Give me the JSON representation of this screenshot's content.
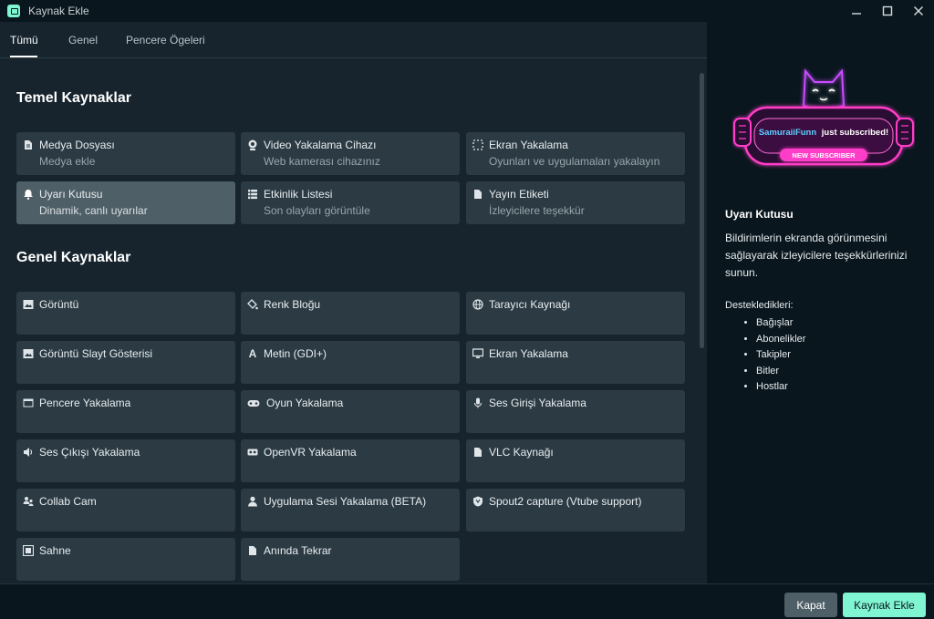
{
  "window": {
    "title": "Kaynak Ekle",
    "minimize_icon": "minimize-icon",
    "maximize_icon": "maximize-icon",
    "close_icon": "close-icon"
  },
  "tabs": [
    {
      "label": "Tümü"
    },
    {
      "label": "Genel"
    },
    {
      "label": "Pencere Ögeleri"
    }
  ],
  "sections": {
    "basic": {
      "title": "Temel Kaynaklar",
      "items": [
        {
          "title": "Medya Dosyası",
          "desc": "Medya ekle",
          "icon": "file-icon"
        },
        {
          "title": "Video Yakalama Cihazı",
          "desc": "Web kamerası cihazınız",
          "icon": "webcam-icon"
        },
        {
          "title": "Ekran Yakalama",
          "desc": "Oyunları ve uygulamaları yakalayın",
          "icon": "screen-capture-icon"
        },
        {
          "title": "Uyarı Kutusu",
          "desc": "Dinamik, canlı uyarılar",
          "icon": "bell-icon"
        },
        {
          "title": "Etkinlik Listesi",
          "desc": "Son olayları görüntüle",
          "icon": "list-icon"
        },
        {
          "title": "Yayın Etiketi",
          "desc": "İzleyicilere teşekkür",
          "icon": "document-icon"
        }
      ]
    },
    "general": {
      "title": "Genel Kaynaklar",
      "items": [
        {
          "title": "Görüntü",
          "icon": "image-icon"
        },
        {
          "title": "Renk Bloğu",
          "icon": "paint-bucket-icon"
        },
        {
          "title": "Tarayıcı Kaynağı",
          "icon": "globe-icon"
        },
        {
          "title": "Görüntü Slayt Gösterisi",
          "icon": "slideshow-icon"
        },
        {
          "title": "Metin (GDI+)",
          "icon": "text-icon"
        },
        {
          "title": "Ekran Yakalama",
          "icon": "monitor-icon"
        },
        {
          "title": "Pencere Yakalama",
          "icon": "window-icon"
        },
        {
          "title": "Oyun Yakalama",
          "icon": "gamepad-icon"
        },
        {
          "title": "Ses Girişi Yakalama",
          "icon": "microphone-icon"
        },
        {
          "title": "Ses Çıkışı Yakalama",
          "icon": "speaker-icon"
        },
        {
          "title": "OpenVR Yakalama",
          "icon": "vr-headset-icon"
        },
        {
          "title": "VLC Kaynağı",
          "icon": "document-icon"
        },
        {
          "title": "Collab Cam",
          "icon": "collab-users-icon"
        },
        {
          "title": "Uygulama Sesi Yakalama (BETA)",
          "icon": "user-icon"
        },
        {
          "title": "Spout2 capture (Vtube support)",
          "icon": "shield-icon"
        },
        {
          "title": "Sahne",
          "icon": "scene-icon"
        },
        {
          "title": "Anında Tekrar",
          "icon": "document-icon"
        }
      ]
    }
  },
  "panel": {
    "preview": {
      "name": "SamuraiiFunn",
      "text": "just subscribed!",
      "badge": "NEW SUBSCRIBER"
    },
    "title": "Uyarı Kutusu",
    "description": "Bildirimlerin ekranda görünmesini sağlayarak izleyicilere teşekkürlerinizi sunun.",
    "supports_label": "Destekledikleri:",
    "supports": [
      "Bağışlar",
      "Abonelikler",
      "Takipler",
      "Bitler",
      "Hostlar"
    ]
  },
  "footer": {
    "close_label": "Kapat",
    "add_label": "Kaynak Ekle"
  },
  "colors": {
    "accent": "#80f5d2",
    "background": "#17242d",
    "card": "#2b3a43",
    "card_active": "#4f5f67",
    "panel": "#09161d",
    "neon_pink": "#ff3ec8"
  }
}
